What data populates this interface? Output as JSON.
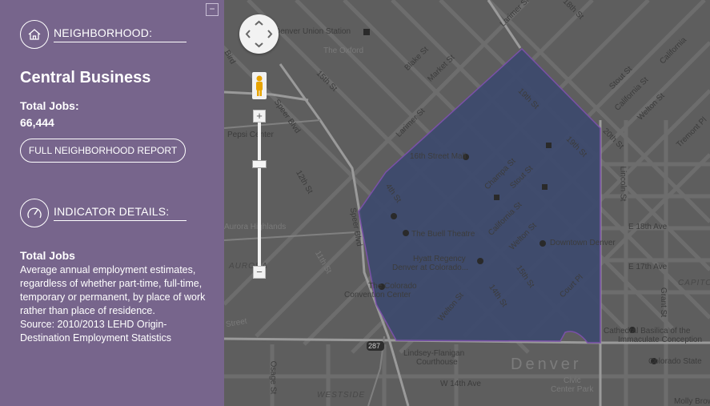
{
  "sidebar": {
    "collapse_label": "−",
    "neighborhood_heading": "NEIGHBORHOOD:",
    "neighborhood_name": "Central Business",
    "total_jobs_label": "Total Jobs:",
    "total_jobs_value": "66,444",
    "report_button": "FULL NEIGHBORHOOD REPORT",
    "indicator_heading": "INDICATOR DETAILS:",
    "indicator_title": "Total Jobs",
    "indicator_description": "Average annual employment estimates, regardless of whether part-time, full-time, temporary or permanent, by place of work rather than place of residence.",
    "indicator_source": "Source: 2010/2013 LEHD Origin-Destination Employment Statistics",
    "icons": {
      "neighborhood": "home-icon",
      "indicator": "gauge-icon"
    },
    "colors": {
      "background": "#77658c"
    }
  },
  "map": {
    "colors": {
      "highlight": "#3d4a6e",
      "highlight_border": "#7a50a8",
      "base": "#5e5e5e"
    },
    "controls": {
      "zoom_in": "+",
      "zoom_out": "−",
      "pan": "pan-control",
      "street_view": "pegman-icon"
    },
    "labels": {
      "union_station": "Denver Union Station",
      "the_oxford": "The Oxford",
      "blake": "Blake St",
      "market": "Market St",
      "larimer_top": "Larimer St",
      "st18": "18th St",
      "california_top": "California",
      "stout_top": "Stout St",
      "california_st": "California St",
      "welton_top": "Welton St",
      "tremont": "Tremont Pl",
      "st15": "15th St",
      "st19a": "19th St",
      "st19b": "19th St",
      "st20": "20th St",
      "bird": "Bird",
      "speer_blvd": "Speer Blvd",
      "pepsi_center": "Pepsi Center",
      "st12": "12th St",
      "larimer_mid": "Larimer St",
      "mall16": "16th Street Mall",
      "champa": "Champa St",
      "stout_mid": "Stout St",
      "st14a": "4th St",
      "lincoln": "Lincoln St",
      "e18": "E 18th Ave",
      "aurora": "Aurora Highlands",
      "speer_blvd2": "Speer Blvd",
      "aurora_area": "AURORA",
      "buell": "The Buell Theatre",
      "california_mid": "California St",
      "welton_mid": "Welton St",
      "downtown_denver": "Downtown Denver",
      "st11": "11th St",
      "hyatt1": "Hyatt Regency",
      "hyatt2": "Denver at Colorado...",
      "e17": "E 17th Ave",
      "colorado_center1": "The Colorado",
      "colorado_center2": "Convention Center",
      "st15b": "15th St",
      "capito": "CAPITO",
      "grant": "Grant St",
      "welton_low": "Welton St",
      "st14b": "14th St",
      "court": "Court Pl",
      "street_left": "Street",
      "cathedral1": "Cathedral Basilica of the",
      "cathedral2": "Immaculate Conception",
      "route287": "287",
      "lindsey1": "Lindsey-Flanigan",
      "lindsey2": "Courthouse",
      "denver": "Denver",
      "colorado_state": "Colorado State",
      "w14th": "W 14th Ave",
      "civic1": "Civic",
      "civic2": "Center Park",
      "osage": "Osage St",
      "westside": "WESTSIDE",
      "molly": "Molly Brow"
    }
  }
}
